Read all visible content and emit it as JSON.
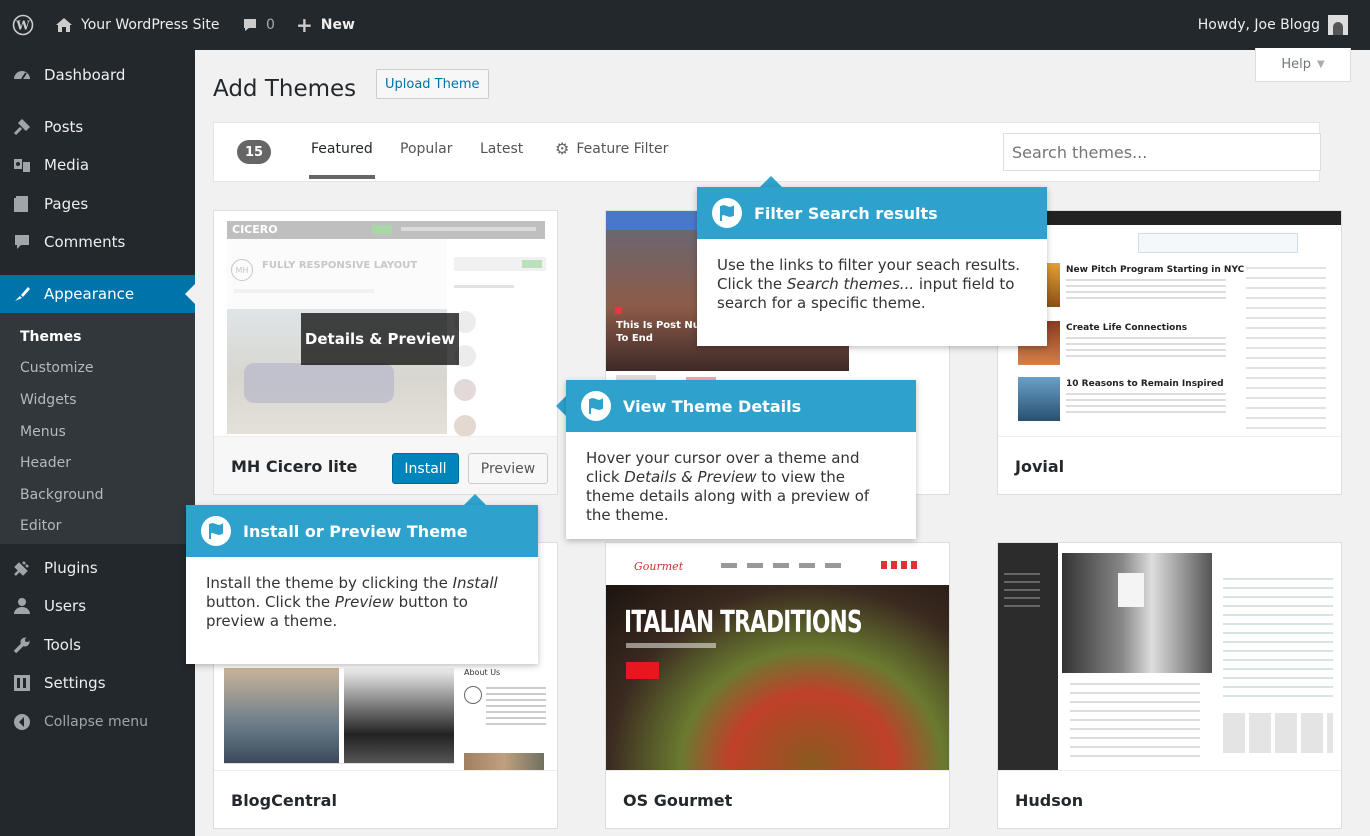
{
  "adminbar": {
    "site_name": "Your WordPress Site",
    "comments_count": "0",
    "new_label": "New",
    "greeting": "Howdy, Joe Blogg"
  },
  "sidebar": {
    "items": [
      {
        "label": "Dashboard",
        "icon": "dashboard-icon"
      },
      {
        "label": "Posts",
        "icon": "pin-icon"
      },
      {
        "label": "Media",
        "icon": "media-icon"
      },
      {
        "label": "Pages",
        "icon": "pages-icon"
      },
      {
        "label": "Comments",
        "icon": "comment-icon"
      },
      {
        "label": "Appearance",
        "icon": "brush-icon"
      },
      {
        "label": "Plugins",
        "icon": "plug-icon"
      },
      {
        "label": "Users",
        "icon": "users-icon"
      },
      {
        "label": "Tools",
        "icon": "wrench-icon"
      },
      {
        "label": "Settings",
        "icon": "settings-icon"
      },
      {
        "label": "Collapse menu",
        "icon": "collapse-icon"
      }
    ],
    "submenu": [
      "Themes",
      "Customize",
      "Widgets",
      "Menus",
      "Header",
      "Background",
      "Editor"
    ]
  },
  "page": {
    "title": "Add Themes",
    "upload_label": "Upload Theme",
    "help_label": "Help"
  },
  "filter": {
    "count": "15",
    "tabs": [
      "Featured",
      "Popular",
      "Latest"
    ],
    "feature_filter": "Feature Filter",
    "search_placeholder": "Search themes..."
  },
  "themes": [
    {
      "name": "MH Cicero lite",
      "install_label": "Install",
      "preview_label": "Preview",
      "details_label": "Details & Preview",
      "shot_brand": "CICERO",
      "shot_heading": "FULLY RESPONSIVE LAYOUT",
      "shot_logo": "MH"
    },
    {
      "name": "",
      "shot_caption": "This Is Post Number T… Seem To End"
    },
    {
      "name": "Jovial",
      "shot_headlines": [
        "New Pitch Program Starting in NYC",
        "Create Life Connections",
        "10 Reasons to Remain Inspired"
      ]
    },
    {
      "name": "BlogCentral",
      "shot_text": "About Us"
    },
    {
      "name": "OS Gourmet",
      "shot_heading": "ITALIAN TRADITIONS",
      "shot_logo": "Gourmet"
    },
    {
      "name": "Hudson"
    }
  ],
  "tips": {
    "filter": {
      "title": "Filter Search results",
      "body_1": "Use the links to filter your seach results. Click the ",
      "body_em": "Search themes...",
      "body_2": " input field to search for a specific theme."
    },
    "details": {
      "title": "View Theme Details",
      "body_1": "Hover your cursor over a theme and click ",
      "body_em": "Details & Preview",
      "body_2": " to view the theme details along with a preview of the theme."
    },
    "install": {
      "title": "Install or Preview Theme",
      "body_1": "Install the theme by clicking the ",
      "body_em1": "Install",
      "body_2": " button. Click the ",
      "body_em2": "Preview",
      "body_3": " button to preview a theme."
    }
  },
  "colors": {
    "accent": "#0073aa",
    "tip_header": "#2ea2cc",
    "adminbar": "#23282d"
  }
}
